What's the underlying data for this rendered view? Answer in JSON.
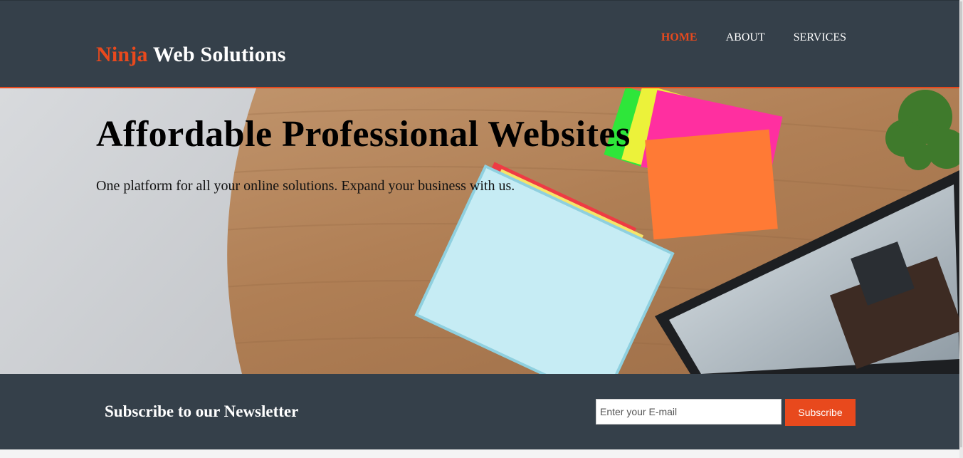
{
  "header": {
    "brand_highlight": "Ninja",
    "brand_rest": " Web Solutions",
    "nav": [
      {
        "label": "Home",
        "current": true
      },
      {
        "label": "About",
        "current": false
      },
      {
        "label": "Services",
        "current": false
      }
    ]
  },
  "showcase": {
    "title": "Affordable Professional Websites",
    "subtitle": "One platform for all your online solutions. Expand your business with us.",
    "background_image": "desk-with-notebooks-laptop-plant"
  },
  "newsletter": {
    "heading": "Subscribe to our Newsletter",
    "email_placeholder": "Enter your E-mail",
    "email_value": "",
    "button_label": "Subscribe"
  },
  "colors": {
    "dark": "#35404a",
    "accent": "#e8491d"
  }
}
